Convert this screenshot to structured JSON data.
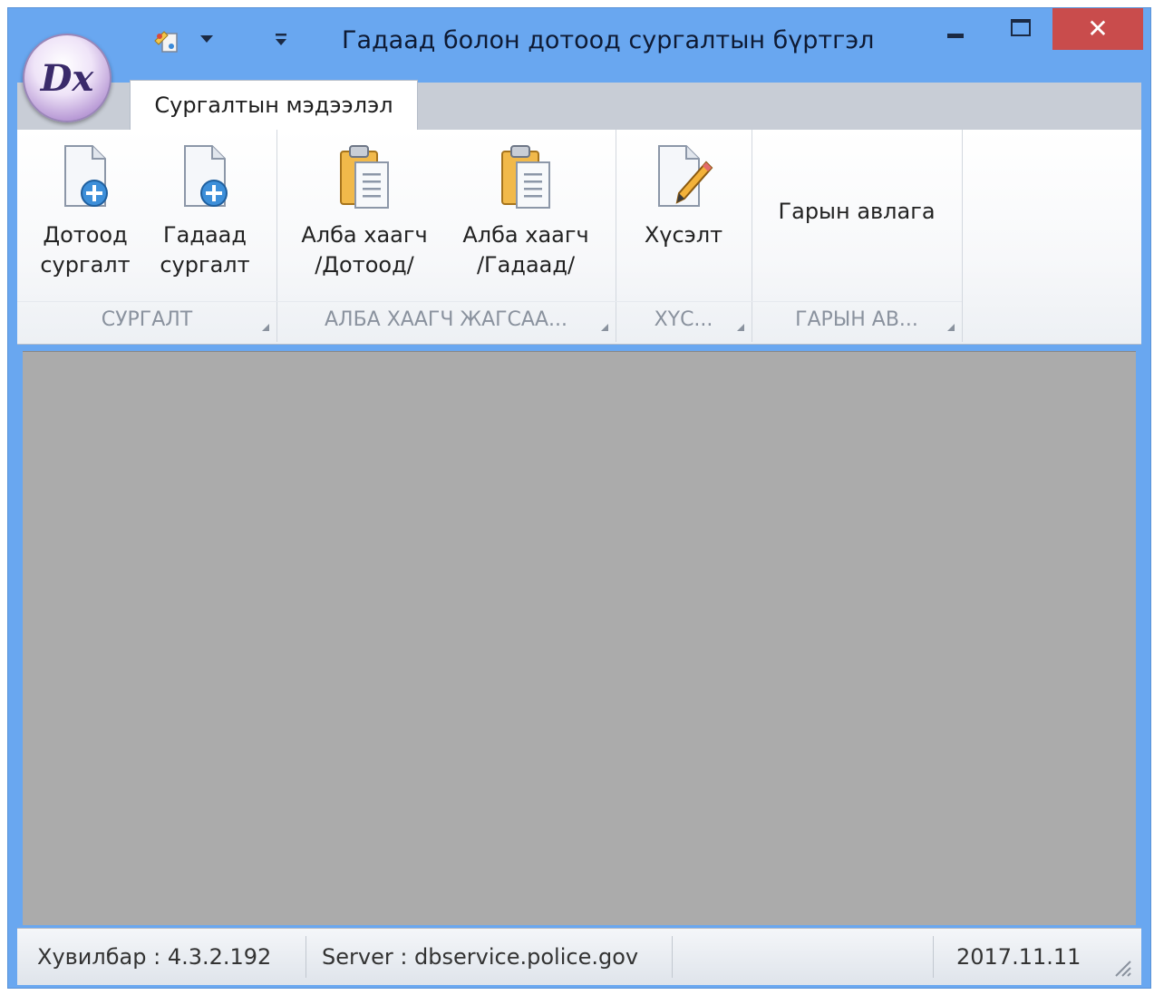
{
  "window": {
    "title": "Гадаад болон дотоод сургалтын бүртгэл",
    "close_glyph": "✕",
    "app_logo_text": "Dx"
  },
  "tabs": [
    {
      "label": "Сургалтын мэдээлэл",
      "active": true
    }
  ],
  "ribbon": {
    "groups": [
      {
        "label": "СУРГАЛТ",
        "buttons": [
          {
            "line1": "Дотоод",
            "line2": "сургалт",
            "icon": "document-add-icon"
          },
          {
            "line1": "Гадаад",
            "line2": "сургалт",
            "icon": "document-add-icon"
          }
        ]
      },
      {
        "label": "АЛБА ХААГЧ ЖАГСАА...",
        "buttons": [
          {
            "line1": "Алба хаагч",
            "line2": "/Дотоод/",
            "icon": "clipboard-icon"
          },
          {
            "line1": "Алба хаагч",
            "line2": "/Гадаад/",
            "icon": "clipboard-icon"
          }
        ]
      },
      {
        "label": "ХҮС...",
        "buttons": [
          {
            "line1": "Хүсэлт",
            "line2": "",
            "icon": "document-edit-icon"
          }
        ]
      },
      {
        "label": "ГАРЫН АВ...",
        "buttons": [
          {
            "line1": "Гарын авлага",
            "line2": ""
          }
        ]
      }
    ]
  },
  "status": {
    "version": "Хувилбар : 4.3.2.192",
    "server": "Server : dbservice.police.gov",
    "date": "2017.11.11"
  },
  "colors": {
    "title_bar": "#69a7f0",
    "close": "#c94c4c",
    "content": "#ababab"
  }
}
